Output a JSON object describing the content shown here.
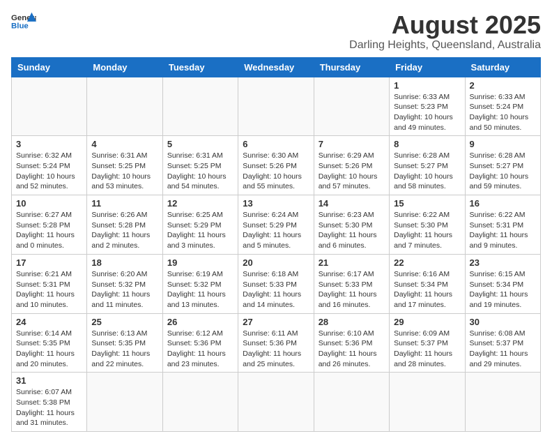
{
  "header": {
    "logo_general": "General",
    "logo_blue": "Blue",
    "title": "August 2025",
    "subtitle": "Darling Heights, Queensland, Australia"
  },
  "weekdays": [
    "Sunday",
    "Monday",
    "Tuesday",
    "Wednesday",
    "Thursday",
    "Friday",
    "Saturday"
  ],
  "weeks": [
    [
      {
        "day": "",
        "info": ""
      },
      {
        "day": "",
        "info": ""
      },
      {
        "day": "",
        "info": ""
      },
      {
        "day": "",
        "info": ""
      },
      {
        "day": "",
        "info": ""
      },
      {
        "day": "1",
        "info": "Sunrise: 6:33 AM\nSunset: 5:23 PM\nDaylight: 10 hours and 49 minutes."
      },
      {
        "day": "2",
        "info": "Sunrise: 6:33 AM\nSunset: 5:24 PM\nDaylight: 10 hours and 50 minutes."
      }
    ],
    [
      {
        "day": "3",
        "info": "Sunrise: 6:32 AM\nSunset: 5:24 PM\nDaylight: 10 hours and 52 minutes."
      },
      {
        "day": "4",
        "info": "Sunrise: 6:31 AM\nSunset: 5:25 PM\nDaylight: 10 hours and 53 minutes."
      },
      {
        "day": "5",
        "info": "Sunrise: 6:31 AM\nSunset: 5:25 PM\nDaylight: 10 hours and 54 minutes."
      },
      {
        "day": "6",
        "info": "Sunrise: 6:30 AM\nSunset: 5:26 PM\nDaylight: 10 hours and 55 minutes."
      },
      {
        "day": "7",
        "info": "Sunrise: 6:29 AM\nSunset: 5:26 PM\nDaylight: 10 hours and 57 minutes."
      },
      {
        "day": "8",
        "info": "Sunrise: 6:28 AM\nSunset: 5:27 PM\nDaylight: 10 hours and 58 minutes."
      },
      {
        "day": "9",
        "info": "Sunrise: 6:28 AM\nSunset: 5:27 PM\nDaylight: 10 hours and 59 minutes."
      }
    ],
    [
      {
        "day": "10",
        "info": "Sunrise: 6:27 AM\nSunset: 5:28 PM\nDaylight: 11 hours and 0 minutes."
      },
      {
        "day": "11",
        "info": "Sunrise: 6:26 AM\nSunset: 5:28 PM\nDaylight: 11 hours and 2 minutes."
      },
      {
        "day": "12",
        "info": "Sunrise: 6:25 AM\nSunset: 5:29 PM\nDaylight: 11 hours and 3 minutes."
      },
      {
        "day": "13",
        "info": "Sunrise: 6:24 AM\nSunset: 5:29 PM\nDaylight: 11 hours and 5 minutes."
      },
      {
        "day": "14",
        "info": "Sunrise: 6:23 AM\nSunset: 5:30 PM\nDaylight: 11 hours and 6 minutes."
      },
      {
        "day": "15",
        "info": "Sunrise: 6:22 AM\nSunset: 5:30 PM\nDaylight: 11 hours and 7 minutes."
      },
      {
        "day": "16",
        "info": "Sunrise: 6:22 AM\nSunset: 5:31 PM\nDaylight: 11 hours and 9 minutes."
      }
    ],
    [
      {
        "day": "17",
        "info": "Sunrise: 6:21 AM\nSunset: 5:31 PM\nDaylight: 11 hours and 10 minutes."
      },
      {
        "day": "18",
        "info": "Sunrise: 6:20 AM\nSunset: 5:32 PM\nDaylight: 11 hours and 11 minutes."
      },
      {
        "day": "19",
        "info": "Sunrise: 6:19 AM\nSunset: 5:32 PM\nDaylight: 11 hours and 13 minutes."
      },
      {
        "day": "20",
        "info": "Sunrise: 6:18 AM\nSunset: 5:33 PM\nDaylight: 11 hours and 14 minutes."
      },
      {
        "day": "21",
        "info": "Sunrise: 6:17 AM\nSunset: 5:33 PM\nDaylight: 11 hours and 16 minutes."
      },
      {
        "day": "22",
        "info": "Sunrise: 6:16 AM\nSunset: 5:34 PM\nDaylight: 11 hours and 17 minutes."
      },
      {
        "day": "23",
        "info": "Sunrise: 6:15 AM\nSunset: 5:34 PM\nDaylight: 11 hours and 19 minutes."
      }
    ],
    [
      {
        "day": "24",
        "info": "Sunrise: 6:14 AM\nSunset: 5:35 PM\nDaylight: 11 hours and 20 minutes."
      },
      {
        "day": "25",
        "info": "Sunrise: 6:13 AM\nSunset: 5:35 PM\nDaylight: 11 hours and 22 minutes."
      },
      {
        "day": "26",
        "info": "Sunrise: 6:12 AM\nSunset: 5:36 PM\nDaylight: 11 hours and 23 minutes."
      },
      {
        "day": "27",
        "info": "Sunrise: 6:11 AM\nSunset: 5:36 PM\nDaylight: 11 hours and 25 minutes."
      },
      {
        "day": "28",
        "info": "Sunrise: 6:10 AM\nSunset: 5:36 PM\nDaylight: 11 hours and 26 minutes."
      },
      {
        "day": "29",
        "info": "Sunrise: 6:09 AM\nSunset: 5:37 PM\nDaylight: 11 hours and 28 minutes."
      },
      {
        "day": "30",
        "info": "Sunrise: 6:08 AM\nSunset: 5:37 PM\nDaylight: 11 hours and 29 minutes."
      }
    ],
    [
      {
        "day": "31",
        "info": "Sunrise: 6:07 AM\nSunset: 5:38 PM\nDaylight: 11 hours and 31 minutes."
      },
      {
        "day": "",
        "info": ""
      },
      {
        "day": "",
        "info": ""
      },
      {
        "day": "",
        "info": ""
      },
      {
        "day": "",
        "info": ""
      },
      {
        "day": "",
        "info": ""
      },
      {
        "day": "",
        "info": ""
      }
    ]
  ]
}
